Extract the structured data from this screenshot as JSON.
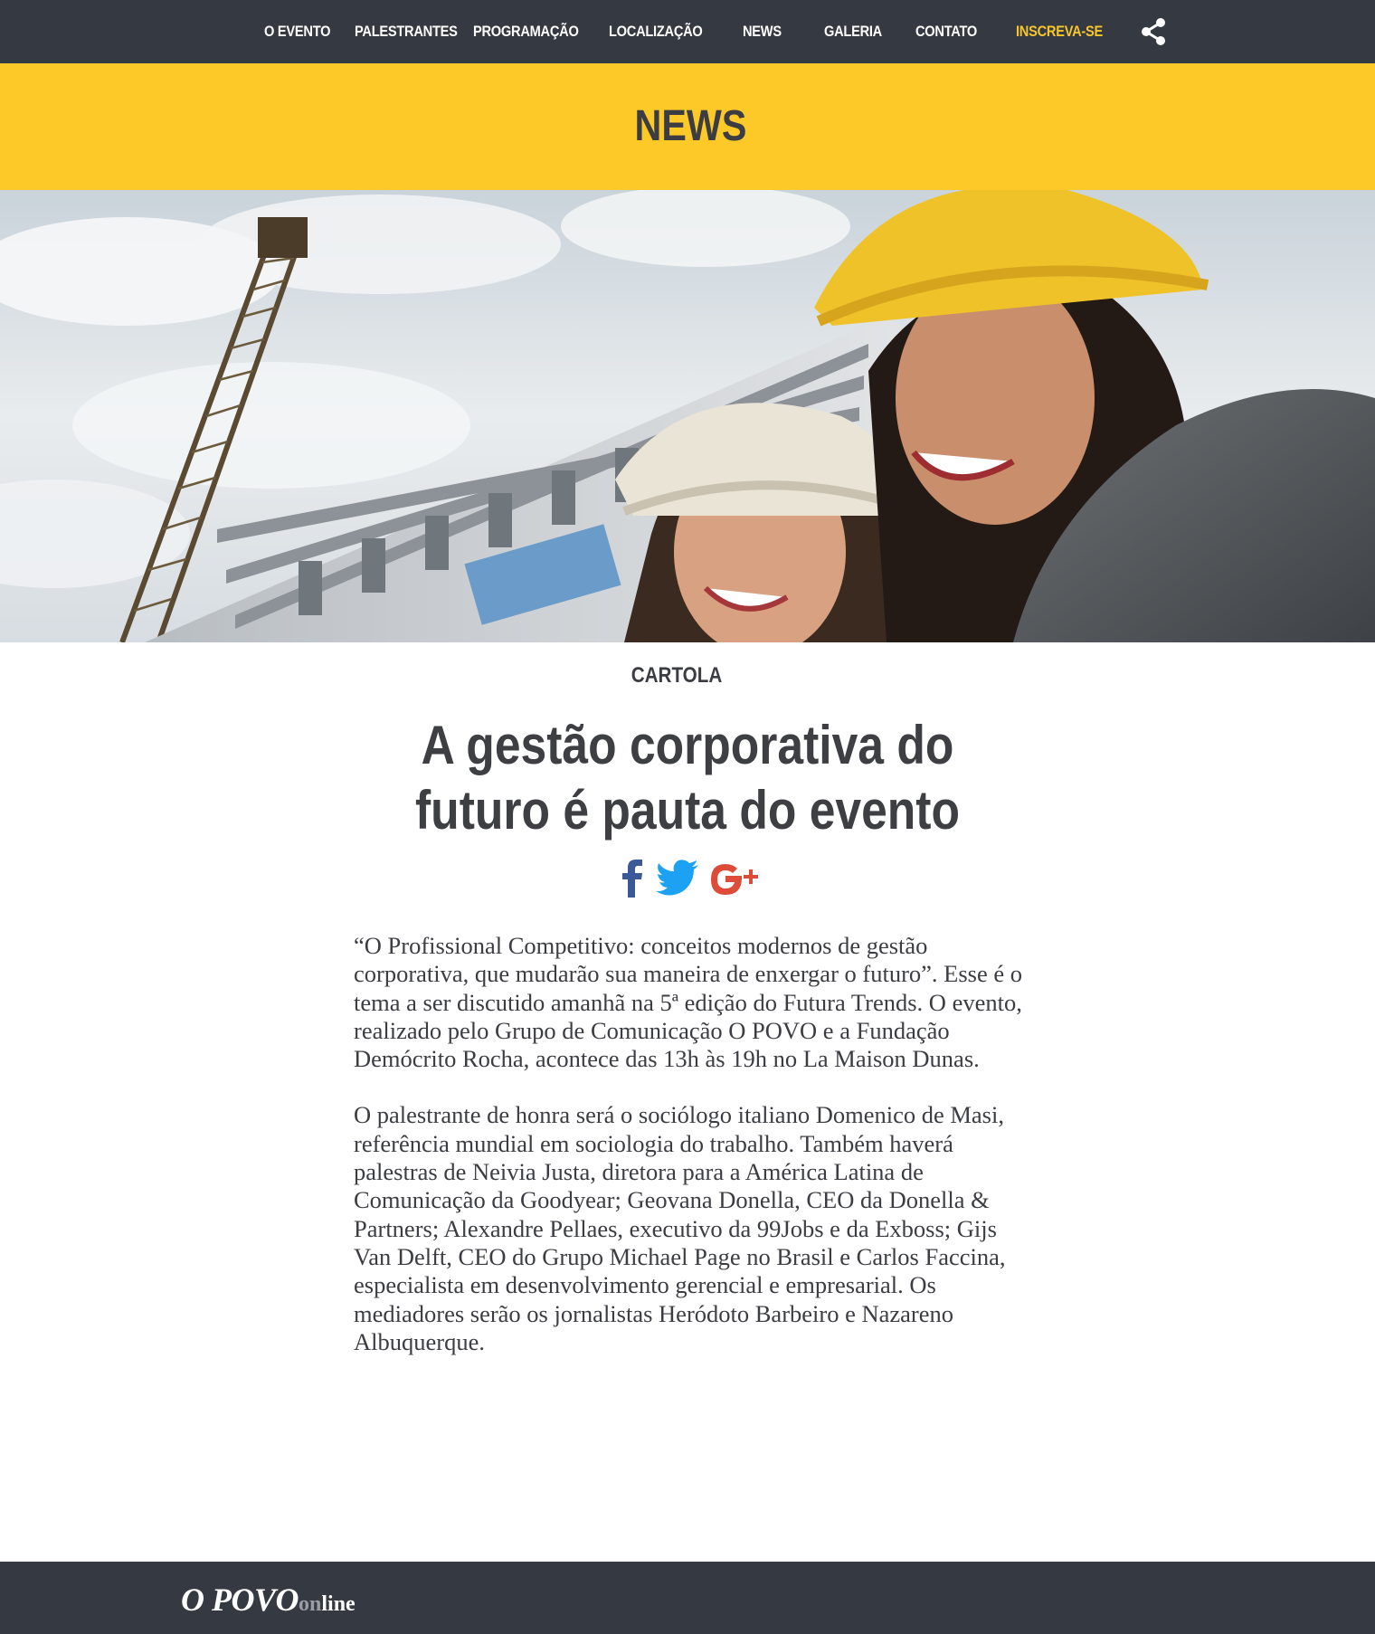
{
  "nav": {
    "items": [
      {
        "label": "O EVENTO"
      },
      {
        "label": "PALESTRANTES"
      },
      {
        "label": "PROGRAMAÇÃO"
      },
      {
        "label": "LOCALIZAÇÃO"
      },
      {
        "label": "NEWS"
      },
      {
        "label": "GALERIA"
      },
      {
        "label": "CONTATO"
      },
      {
        "label": "INSCREVA-SE"
      }
    ],
    "share_icon": "share-icon"
  },
  "banner": {
    "title": "NEWS"
  },
  "hero": {
    "icon": "hero-photo",
    "description_visible": false
  },
  "article": {
    "category": "CARTOLA",
    "headline": "A gestão corporativa do futuro é pauta do evento",
    "social": {
      "facebook_icon": "facebook-icon",
      "twitter_icon": "twitter-icon",
      "googleplus_icon": "google-plus-icon"
    },
    "paragraphs": [
      "“O Profissional Competitivo: conceitos modernos de gestão corporativa, que mudarão sua maneira de enxergar o futuro”. Esse é o tema a ser discutido amanhã na 5ª edição do Futura Trends. O evento, realizado pelo Grupo de Comunicação O POVO e a Fundação Demócrito Rocha, acontece das 13h às 19h no La Maison Dunas.",
      "O palestrante de honra será o sociólogo italiano Domenico de Masi, referência mundial em sociologia do trabalho. Também haverá palestras de Neivia Justa, diretora para a América Latina de Comunicação da Goodyear; Geovana Donella, CEO da Donella & Partners; Alexandre Pellaes, executivo da 99Jobs e da Exboss; Gijs Van Delft, CEO do Grupo Michael Page no Brasil e Carlos Faccina, especialista em desenvolvimento gerencial e empresarial. Os mediadores serão os jornalistas Heródoto Barbeiro e Nazareno Albuquerque."
    ]
  },
  "footer": {
    "logo_brand": "O POVO",
    "logo_suffix_a": "on",
    "logo_suffix_b": "line"
  },
  "colors": {
    "nav_bg": "#343942",
    "accent_yellow": "#fdc928",
    "cta_text": "#f7c62d",
    "text_dark": "#3b3d42",
    "facebook": "#3b5998",
    "twitter": "#1da1f2",
    "google_plus": "#dd4b39"
  }
}
